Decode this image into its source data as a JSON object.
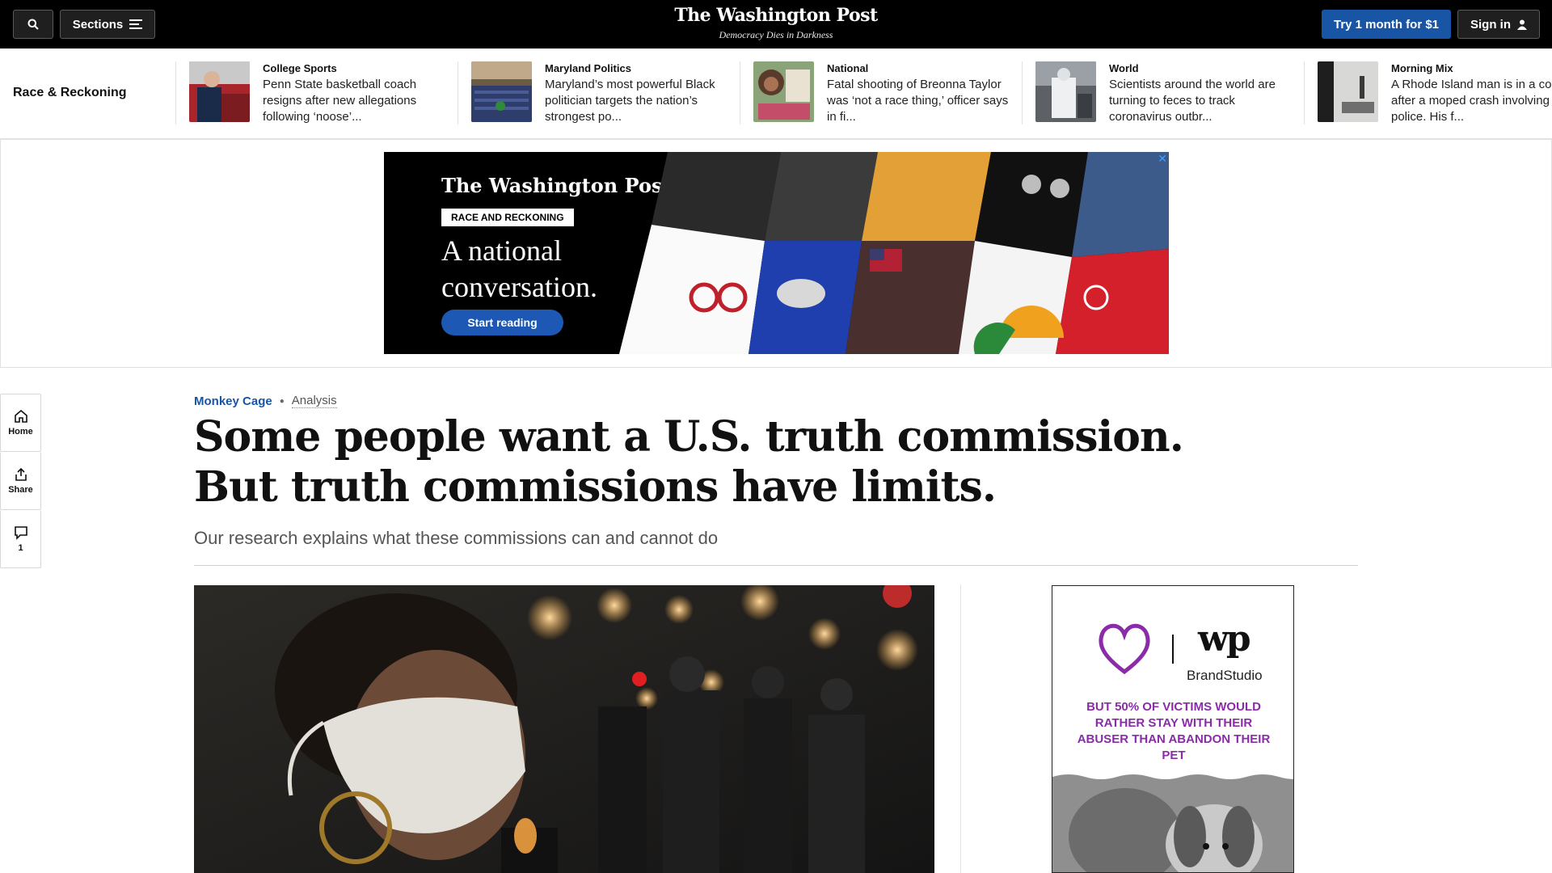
{
  "topbar": {
    "sections_label": "Sections",
    "masthead": "The Washington Post",
    "tagline": "Democracy Dies in Darkness",
    "try_label": "Try 1 month for $1",
    "signin_label": "Sign in"
  },
  "strip": {
    "title": "Race & Reckoning",
    "stories": [
      {
        "kicker": "College Sports",
        "headline": "Penn State basketball coach resigns after new allegations following ‘noose’..."
      },
      {
        "kicker": "Maryland Politics",
        "headline": "Maryland’s most powerful Black politician targets the nation’s strongest po..."
      },
      {
        "kicker": "National",
        "headline": "Fatal shooting of Breonna Taylor was ‘not a race thing,’ officer says in fi..."
      },
      {
        "kicker": "World",
        "headline": "Scientists around the world are turning to feces to track coronavirus outbr..."
      },
      {
        "kicker": "Morning Mix",
        "headline": "A Rhode Island man is in a co after a moped crash involving police. His f..."
      }
    ]
  },
  "ad_banner": {
    "logo": "The Washington Post",
    "badge": "RACE AND RECKONING",
    "headline": "A national conversation.",
    "cta": "Start reading",
    "close": "✕"
  },
  "rail": {
    "home": "Home",
    "share": "Share",
    "comments": "1"
  },
  "article": {
    "category": "Monkey Cage",
    "type": "Analysis",
    "title": "Some people want a U.S. truth commission. But truth commissions have limits.",
    "subtitle": "Our research explains what these commissions can and cannot do"
  },
  "side_ad": {
    "brand": "BrandStudio",
    "mark": "wp",
    "message": "BUT 50% OF VICTIMS WOULD RATHER STAY WITH THEIR ABUSER THAN ABANDON THEIR PET"
  },
  "colors": {
    "accent": "#1955a5",
    "topbar": "#000000",
    "ad_message": "#8a2ca8"
  }
}
